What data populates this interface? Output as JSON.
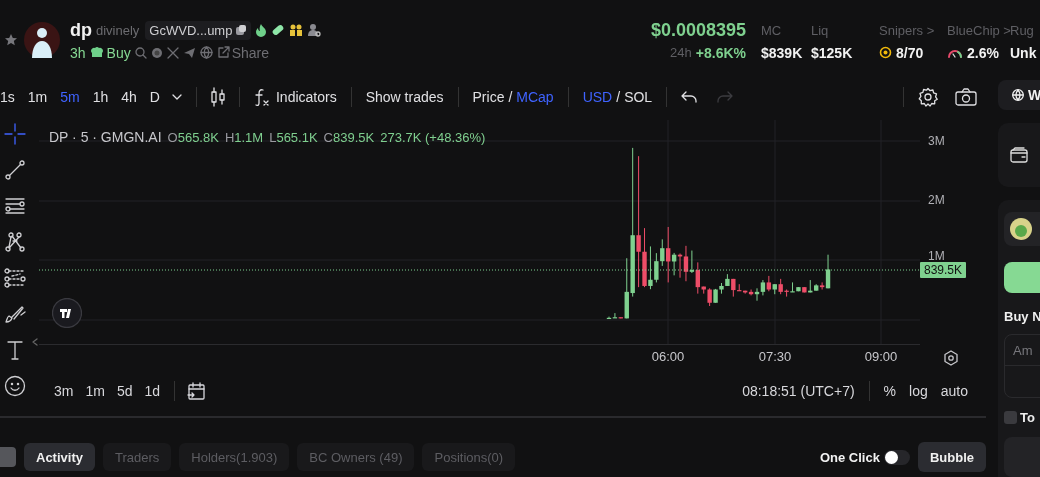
{
  "token": {
    "symbol": "dp",
    "name": "divinely",
    "address": "GcWVD...ump",
    "age": "3h",
    "action": "Buy",
    "share": "Share"
  },
  "price": {
    "value": "$0.0008395",
    "period": "24h",
    "change": "+8.6K%"
  },
  "stats": [
    {
      "label": "MC",
      "value": "$839K",
      "kind": "plain"
    },
    {
      "label": "Liq",
      "value": "$125K",
      "kind": "plain"
    },
    {
      "label": "Snipers >",
      "value": "8/70",
      "kind": "target"
    },
    {
      "label": "BlueChip >",
      "value": "2.6%",
      "kind": "gauge"
    },
    {
      "label": "Rug",
      "value": "Unk",
      "kind": "plain"
    }
  ],
  "intervals": [
    {
      "label": "1s",
      "selected": false
    },
    {
      "label": "1m",
      "selected": false
    },
    {
      "label": "5m",
      "selected": true
    },
    {
      "label": "1h",
      "selected": false
    },
    {
      "label": "4h",
      "selected": false
    },
    {
      "label": "D",
      "selected": false
    }
  ],
  "toolbar": {
    "indicators": "Indicators",
    "show_trades": "Show trades",
    "price_modes": [
      {
        "label": "Price",
        "selected": false
      },
      {
        "label": "MCap",
        "selected": true
      }
    ],
    "price_separator": "/",
    "currencies": [
      {
        "label": "USD",
        "selected": true
      },
      {
        "label": "SOL",
        "selected": false
      }
    ],
    "currency_separator": "/"
  },
  "drawing_tools": [
    {
      "kind": "crosshair",
      "selected": true
    },
    {
      "kind": "trend-line",
      "selected": false
    },
    {
      "kind": "lines",
      "selected": false
    },
    {
      "kind": "pattern",
      "selected": false
    },
    {
      "kind": "fib",
      "selected": false
    },
    {
      "kind": "brush",
      "selected": false
    },
    {
      "kind": "text",
      "selected": false
    },
    {
      "kind": "emoji",
      "selected": false
    }
  ],
  "chart": {
    "legend": {
      "title": "DP · 5 · GMGN.AI",
      "values": [
        {
          "key": "O",
          "value": "565.8K"
        },
        {
          "key": "H",
          "value": "1.1M"
        },
        {
          "key": "L",
          "value": "565.1K"
        },
        {
          "key": "C",
          "value": "839.5K"
        }
      ],
      "change": "273.7K (+48.36%)"
    },
    "y_labels": [
      "3M",
      "2M",
      "1M"
    ],
    "last_price": "839.5K",
    "x_labels": [
      "06:00",
      "07:30",
      "09:00"
    ]
  },
  "ranges": [
    "3m",
    "1m",
    "5d",
    "1d"
  ],
  "clock": "08:18:51 (UTC+7)",
  "scale_options": [
    "%",
    "log",
    "auto"
  ],
  "tabs": [
    {
      "label": "Activity",
      "selected": true
    },
    {
      "label": "Traders",
      "selected": false
    },
    {
      "label": "Holders(1.903)",
      "selected": false
    },
    {
      "label": "BC Owners (49)",
      "selected": false
    },
    {
      "label": "Positions(0)",
      "selected": false
    }
  ],
  "one_click": {
    "label": "One Click",
    "on": false
  },
  "bubble": "Bubble",
  "side": {
    "web_button": "W",
    "buy_label": "Buy N",
    "amount_placeholder": "Am",
    "checkbox": {
      "label": "To",
      "checked": false
    }
  }
}
